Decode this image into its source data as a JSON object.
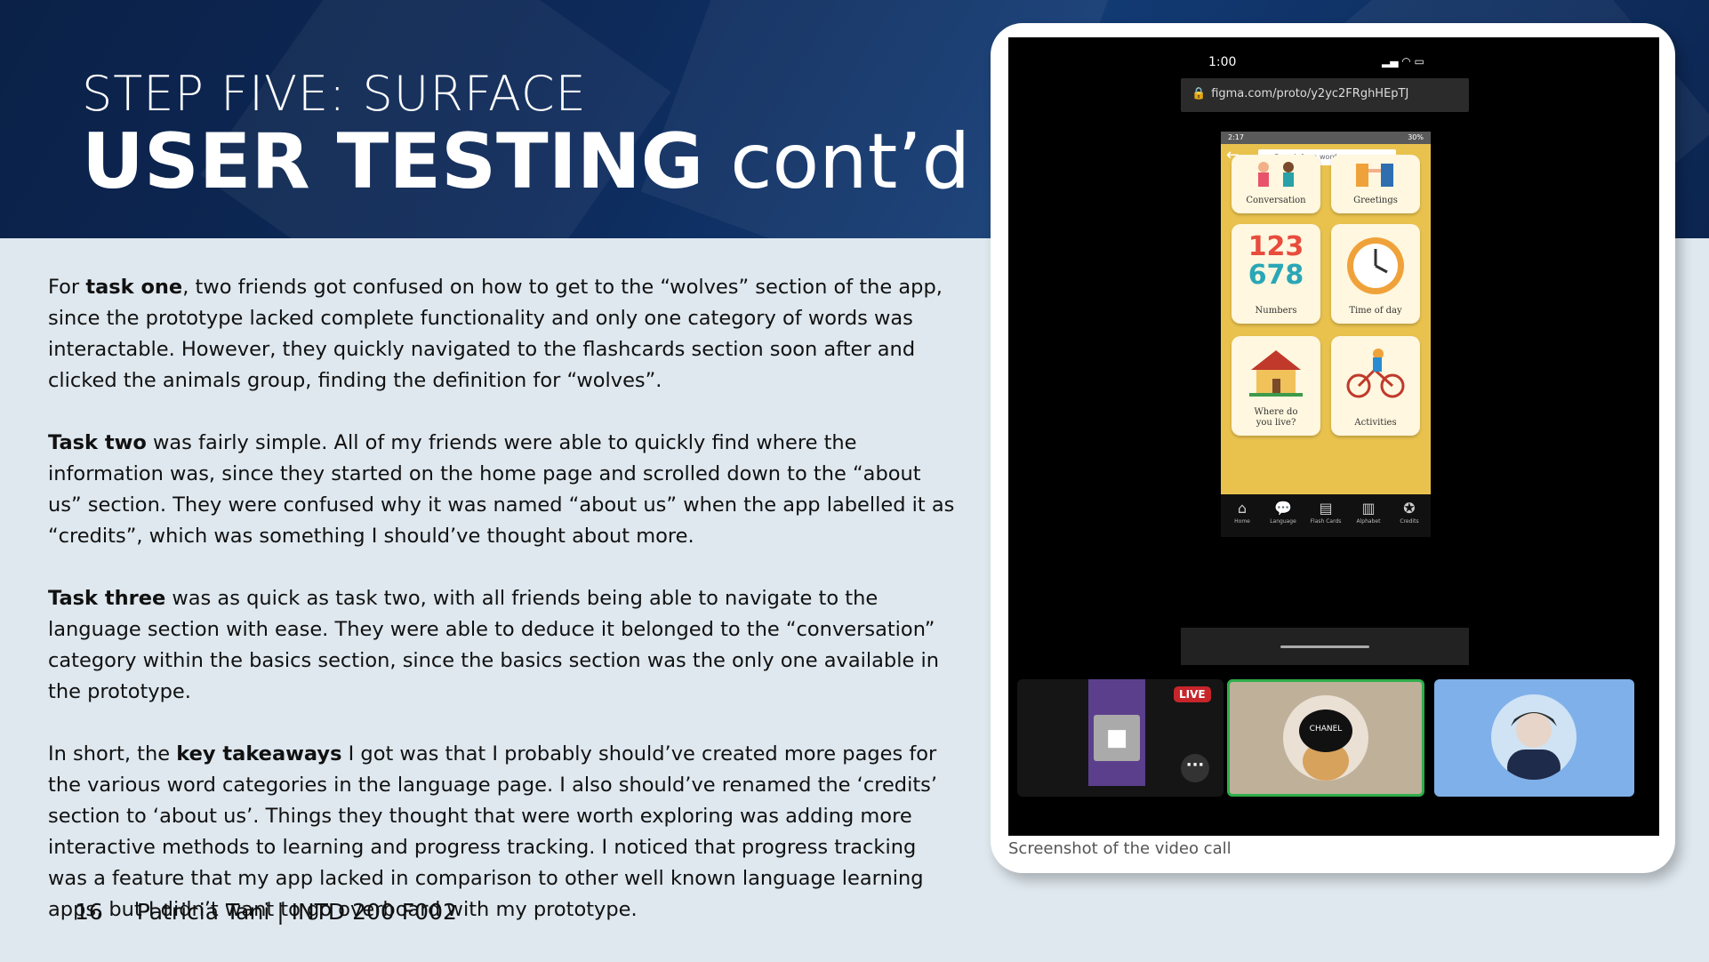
{
  "header": {
    "step_title": "STEP FIVE: SURFACE",
    "main_title_bold": "USER TESTING",
    "main_title_light": "cont’d"
  },
  "paragraphs": [
    {
      "lead": "For ",
      "bold": "task one",
      "rest": ", two friends got confused on how to get to the “wolves” section of the app, since the prototype lacked complete functionality and only one category of words was interactable. However, they quickly navigated to the flashcards section soon after and clicked the animals group, finding the definition for “wolves”."
    },
    {
      "lead": "",
      "bold": "Task two",
      "rest": " was fairly simple. All of my friends were able to quickly find where the information was, since they started on the home page and scrolled down to the “about us” section. They were confused why it was named “about us” when the app labelled it as “credits”, which was something I should’ve thought about more."
    },
    {
      "lead": "",
      "bold": "Task three",
      "rest": " was as quick as task two, with all friends being able to navigate to the language section with ease. They were able to deduce it belonged to the “conversation” category within the basics section, since the basics section was the only one available in the prototype."
    },
    {
      "lead": "In short, the ",
      "bold": "key takeaways",
      "rest": " I got was that I probably should’ve created more pages for the various word categories in the language page. I also should’ve renamed the ‘credits’ section to ‘about us’. Things they thought that were worth exploring was adding more interactive methods to learning and progress tracking. I noticed that progress tracking was a feature that my app lacked in comparison to other well known language learning apps, but I didn’t want to go overboard with my prototype."
    }
  ],
  "footer": {
    "page_number": "16",
    "author": "Patricia Tani | INTD 200 F002"
  },
  "screenshot": {
    "caption": "Screenshot of the video call",
    "status_time": "1:00",
    "url": "figma.com/proto/y2yc2FRghHEpTJ",
    "phone_status_left": "2:17",
    "phone_status_right": "30%",
    "search_placeholder": "Search for a word...",
    "tiles": [
      "Conversation",
      "Greetings",
      "Numbers",
      "Time of day",
      "Where do you live?",
      "Activities"
    ],
    "numbers_art": [
      "123",
      "678"
    ],
    "nav": [
      "Home",
      "Language",
      "Flash Cards",
      "Alphabet",
      "Credits"
    ],
    "live_badge": "LIVE",
    "hat_text": "CHANEL"
  },
  "colors": {
    "header_bg": "#0d2a5a",
    "body_bg": "#dfe8ef",
    "app_yellow": "#e9c24e",
    "live_red": "#c7252b",
    "speaker_border": "#2fae4a"
  }
}
